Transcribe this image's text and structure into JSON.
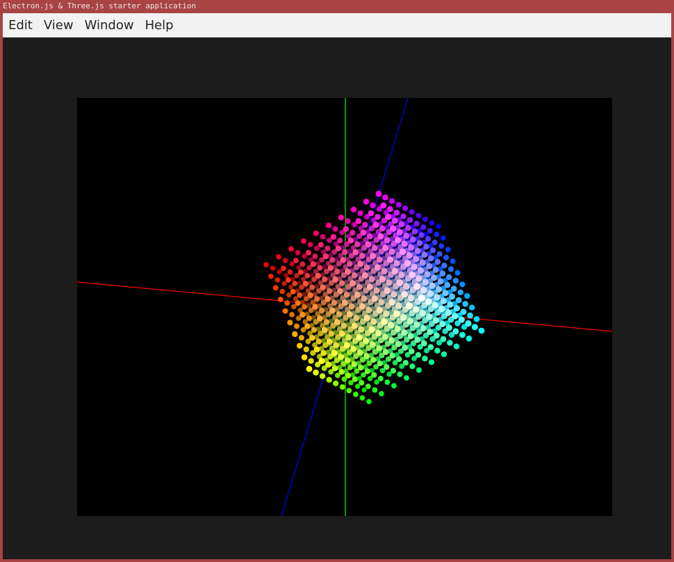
{
  "window": {
    "title": "Electron.js & Three.js starter application",
    "frame_color": "#a84444"
  },
  "menubar": {
    "items": [
      {
        "id": "edit",
        "label": "Edit"
      },
      {
        "id": "view",
        "label": "View"
      },
      {
        "id": "window",
        "label": "Window"
      },
      {
        "id": "help",
        "label": "Help"
      }
    ]
  },
  "scene": {
    "background": "#000000",
    "axes": {
      "x_color": "#ff0000",
      "y_color": "#00ff00",
      "z_color": "#0000ff"
    },
    "point_cube": {
      "grid_size": 10,
      "color_mapping": "RGB cube"
    }
  }
}
